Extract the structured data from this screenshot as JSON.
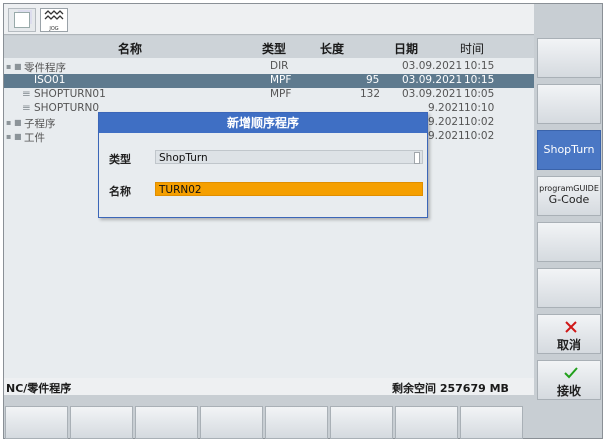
{
  "header": {
    "col_name": "名称",
    "col_type": "类型",
    "col_length": "长度",
    "col_date": "日期",
    "col_time": "时间"
  },
  "rows": [
    {
      "prefix": "▪ ■",
      "name": "零件程序",
      "type": "DIR",
      "length": "",
      "date": "03.09.2021",
      "time": "10:15"
    },
    {
      "prefix": "",
      "name": "ISO01",
      "type": "MPF",
      "length": "95",
      "date": "03.09.2021",
      "time": "10:15"
    },
    {
      "prefix": "≡",
      "name": "SHOPTURN01",
      "type": "MPF",
      "length": "132",
      "date": "03.09.2021",
      "time": "10:05"
    },
    {
      "prefix": "≡",
      "name": "SHOPTURN0",
      "type": "",
      "length": "",
      "date": "9.2021",
      "time": "10:10"
    },
    {
      "prefix": "▪ ■",
      "name": "子程序",
      "type": "",
      "length": "",
      "date": "9.2021",
      "time": "10:02"
    },
    {
      "prefix": "▪ ■",
      "name": "工件",
      "type": "",
      "length": "",
      "date": "9.2021",
      "time": "10:02"
    }
  ],
  "dialog": {
    "title": "新增顺序程序",
    "type_label": "类型",
    "type_value": "ShopTurn",
    "name_label": "名称",
    "name_value": "TURN02"
  },
  "status": {
    "path": "NC/零件程序",
    "free_space": "剩余空间 257679 MB"
  },
  "softkeys": {
    "shopturn": "ShopTurn",
    "programguide_top": "programGUIDE",
    "programguide_bottom": "G-Code",
    "cancel": "取消",
    "accept": "接收"
  },
  "top": {
    "jog": "JOG"
  },
  "colors": {
    "selected_row": "#5e7a8e",
    "dialog_title": "#3f6fc4",
    "name_field": "#f59f00",
    "active_softkey": "#4a77c4"
  }
}
